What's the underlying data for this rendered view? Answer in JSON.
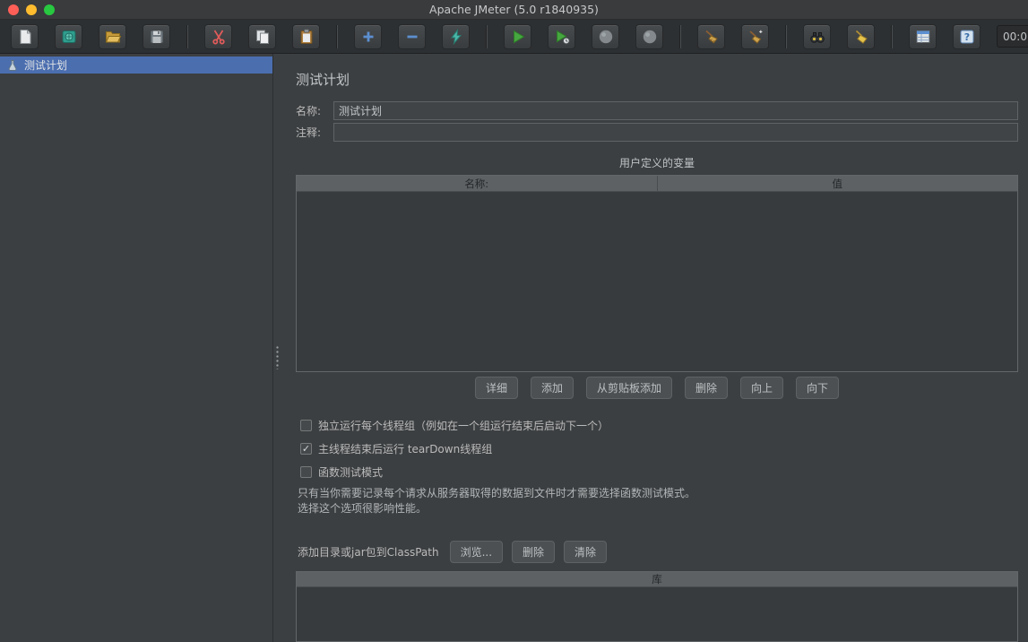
{
  "window": {
    "title": "Apache JMeter (5.0 r1840935)"
  },
  "titlebar": {
    "traffic_lights": [
      "close",
      "minimize",
      "zoom"
    ]
  },
  "toolbar": {
    "timer": "00:0",
    "buttons": [
      "new",
      "templates",
      "open",
      "save",
      "cut",
      "copy",
      "paste",
      "expand-all",
      "collapse-all",
      "toggle",
      "start",
      "start-no-pauses",
      "stop",
      "shutdown",
      "clear",
      "clear-all",
      "search",
      "search-reset",
      "function-helper",
      "help"
    ]
  },
  "tree": {
    "items": [
      {
        "label": "测试计划",
        "icon": "test-plan-icon",
        "selected": true
      }
    ]
  },
  "main": {
    "title": "测试计划",
    "name_label": "名称:",
    "name_value": "测试计划",
    "comment_label": "注释:",
    "comment_value": "",
    "variables": {
      "title": "用户定义的变量",
      "columns": [
        "名称:",
        "值"
      ],
      "rows": []
    },
    "variable_buttons": [
      "详细",
      "添加",
      "从剪贴板添加",
      "删除",
      "向上",
      "向下"
    ],
    "checkboxes": [
      {
        "label": "独立运行每个线程组（例如在一个组运行结束后启动下一个）",
        "checked": false
      },
      {
        "label": "主线程结束后运行 tearDown线程组",
        "checked": true
      },
      {
        "label": "函数测试模式",
        "checked": false
      }
    ],
    "note_lines": [
      "只有当你需要记录每个请求从服务器取得的数据到文件时才需要选择函数测试模式。",
      "选择这个选项很影响性能。"
    ],
    "classpath": {
      "label": "添加目录或jar包到ClassPath",
      "buttons": [
        "浏览...",
        "删除",
        "清除"
      ],
      "table_header": "库"
    }
  },
  "colors": {
    "selection_blue": "#4b6eaf",
    "traffic_red": "#ff5f57",
    "traffic_yellow": "#febc2e",
    "traffic_green": "#28c840",
    "panel_bg": "#3c3f41"
  }
}
